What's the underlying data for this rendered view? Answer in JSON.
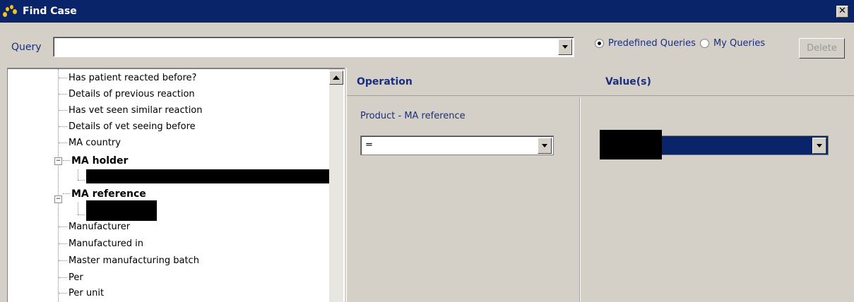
{
  "window": {
    "title": "Find Case",
    "close_glyph": "✕"
  },
  "query_bar": {
    "label": "Query",
    "value": "",
    "radio_predefined": "Predefined Queries",
    "radio_my": "My Queries",
    "selected_radio": "Predefined Queries",
    "delete_label": "Delete"
  },
  "tree": {
    "items": [
      {
        "label": "Has patient reacted before?"
      },
      {
        "label": "Details of previous reaction"
      },
      {
        "label": "Has vet seen similar reaction"
      },
      {
        "label": "Details of vet seeing before"
      },
      {
        "label": "MA country"
      },
      {
        "label": "MA holder"
      },
      {
        "label": "MA reference"
      },
      {
        "label": "Manufacturer"
      },
      {
        "label": "Manufactured in"
      },
      {
        "label": "Master manufacturing batch"
      },
      {
        "label": "Per"
      },
      {
        "label": "Per unit"
      }
    ],
    "expander_glyph": "−"
  },
  "right_pane": {
    "operation_header": "Operation",
    "values_header": "Value(s)",
    "field_label": "Product - MA reference",
    "operation_value": "="
  },
  "colors": {
    "titlebar": "#0a246a",
    "label_blue": "#1a2e80",
    "window_bg": "#d4d0c8"
  },
  "icons": [
    "paw-icon",
    "close-icon",
    "chevron-down-icon",
    "scroll-up-arrow-icon",
    "tree-collapse-icon"
  ]
}
